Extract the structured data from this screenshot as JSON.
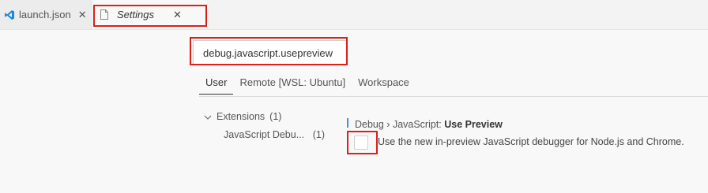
{
  "tabs": {
    "launch": {
      "label": "launch.json"
    },
    "settings": {
      "label": "Settings"
    }
  },
  "search": {
    "value": "debug.javascript.usepreview"
  },
  "scopes": [
    "User",
    "Remote [WSL: Ubuntu]",
    "Workspace"
  ],
  "toc": {
    "extensions_label": "Extensions",
    "extensions_count": "(1)",
    "js_label": "JavaScript Debu...",
    "js_count": "(1)"
  },
  "setting": {
    "category": "Debug › JavaScript: ",
    "name": "Use Preview",
    "description": "Use the new in-preview JavaScript debugger for Node.js and Chrome.",
    "checked": false
  },
  "colors": {
    "accent": "#007acc",
    "highlight": "#d9201a",
    "modified_bar": "#3b8eea"
  },
  "icons": {
    "launch_tab": "vscode-logo-icon",
    "settings_tab": "file-icon",
    "close": "close-icon",
    "collapse": "chevron-down-icon"
  }
}
